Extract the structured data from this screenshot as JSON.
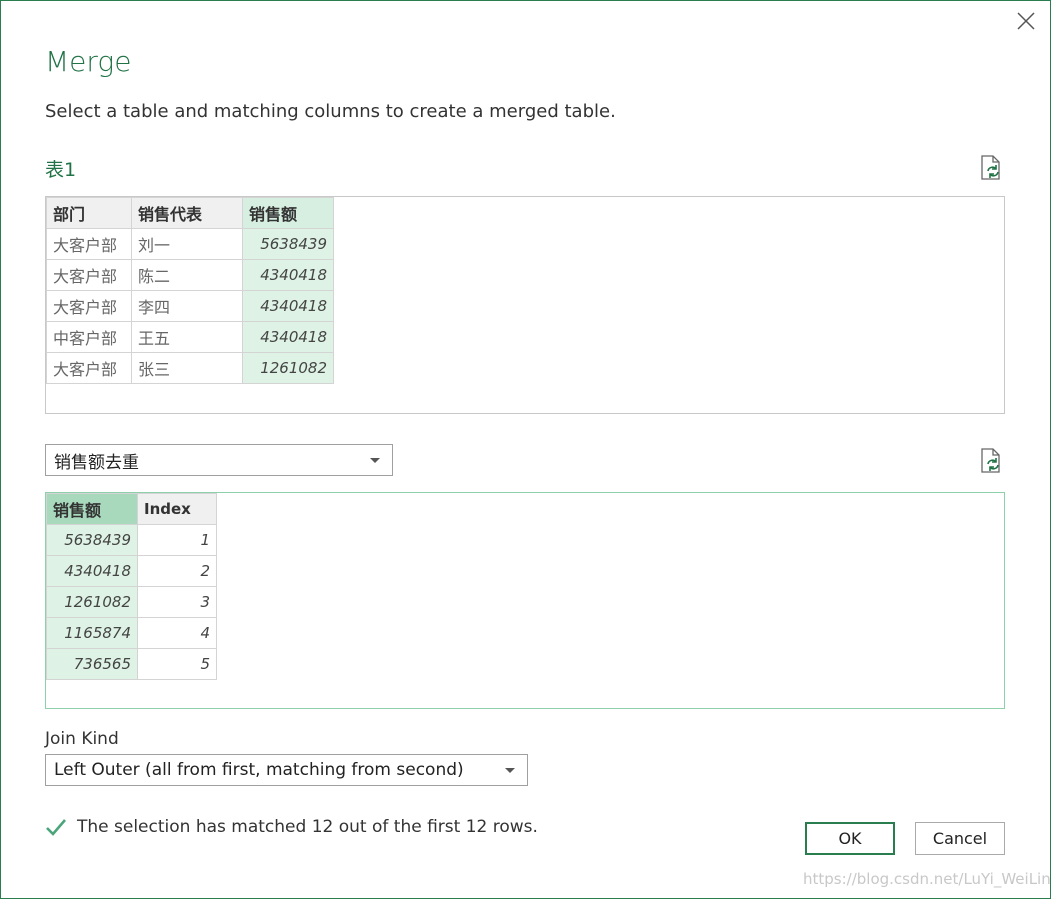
{
  "dialog": {
    "title": "Merge",
    "subtitle": "Select a table and matching columns to create a merged table."
  },
  "table1": {
    "label": "表1",
    "columns": [
      "部门",
      "销售代表",
      "销售额"
    ],
    "rows": [
      [
        "大客户部",
        "刘一",
        "5638439"
      ],
      [
        "大客户部",
        "陈二",
        "4340418"
      ],
      [
        "大客户部",
        "李四",
        "4340418"
      ],
      [
        "中客户部",
        "王五",
        "4340418"
      ],
      [
        "大客户部",
        "张三",
        "1261082"
      ]
    ],
    "selected_column": "销售额"
  },
  "table2": {
    "selected_table": "销售额去重",
    "columns": [
      "销售额",
      "Index"
    ],
    "rows": [
      [
        "5638439",
        "1"
      ],
      [
        "4340418",
        "2"
      ],
      [
        "1261082",
        "3"
      ],
      [
        "1165874",
        "4"
      ],
      [
        "736565",
        "5"
      ]
    ],
    "selected_column": "销售额"
  },
  "join": {
    "label": "Join Kind",
    "selected": "Left Outer (all from first, matching from second)"
  },
  "status": {
    "text": "The selection has matched 12 out of the first 12 rows.",
    "icon": "checkmark-icon"
  },
  "buttons": {
    "ok": "OK",
    "cancel": "Cancel"
  },
  "watermark": "https://blog.csdn.net/LuYi_WeiLin",
  "colors": {
    "accent": "#217346",
    "selected_header": "#d6efe1",
    "selected_cell": "#def3e6",
    "border_active": "#8fd0ac"
  }
}
